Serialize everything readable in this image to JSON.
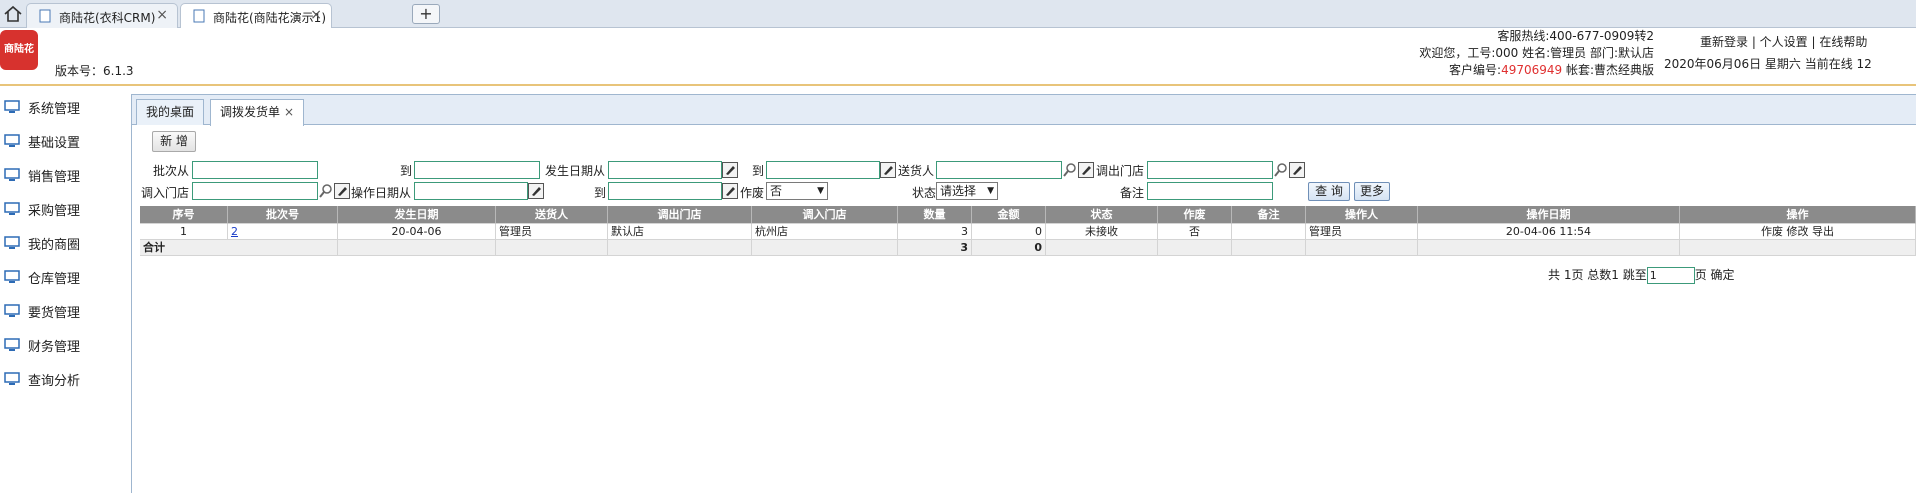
{
  "browser": {
    "tabs": [
      {
        "title": "商陆花(衣科CRM)"
      },
      {
        "title": "商陆花(商陆花演示1)"
      }
    ],
    "new_tab": "+"
  },
  "header": {
    "logo_text": "商陆花",
    "version": "版本号：6.1.3",
    "hotline": "客服热线:400-677-0909转2",
    "welcome": "欢迎您，工号:000 姓名:管理员 部门:默认店",
    "customer_label": "客户编号:",
    "customer_no": "49706949",
    "account": " 帐套:曹杰经典版",
    "links": "重新登录 | 个人设置 | 在线帮助",
    "date_online": "2020年06月06日 星期六 当前在线 12"
  },
  "sidebar": {
    "items": [
      {
        "label": "系统管理"
      },
      {
        "label": "基础设置"
      },
      {
        "label": "销售管理"
      },
      {
        "label": "采购管理"
      },
      {
        "label": "我的商圈"
      },
      {
        "label": "仓库管理"
      },
      {
        "label": "要货管理"
      },
      {
        "label": "财务管理"
      },
      {
        "label": "查询分析"
      }
    ]
  },
  "page_tabs": [
    {
      "label": "我的桌面"
    },
    {
      "label": "调拨发货单",
      "close": "×"
    }
  ],
  "toolbar": {
    "add_label": "新 增"
  },
  "filters": {
    "batch_from": "批次从",
    "batch_to": "到",
    "date_from": "发生日期从",
    "date_to": "到",
    "sender": "送货人",
    "out_store": "调出门店",
    "in_store": "调入门店",
    "op_date_from": "操作日期从",
    "op_date_to": "到",
    "void": "作废",
    "void_value": "否",
    "status": "状态",
    "status_value": "请选择",
    "remark": "备注",
    "query_label": "查 询",
    "more_label": "更多"
  },
  "table": {
    "columns": [
      "序号",
      "批次号",
      "发生日期",
      "送货人",
      "调出门店",
      "调入门店",
      "数量",
      "金额",
      "状态",
      "作废",
      "备注",
      "操作人",
      "操作日期",
      "操作"
    ],
    "rows": [
      {
        "no": "1",
        "batch": "2",
        "date": "20-04-06",
        "sender": "管理员",
        "out": "默认店",
        "in": "杭州店",
        "qty": "3",
        "amount": "0",
        "status": "未接收",
        "void": "否",
        "remark": "",
        "operator": "管理员",
        "op_date": "20-04-06 11:54",
        "actions": "作废 修改 导出"
      }
    ],
    "footer": {
      "label": "合计",
      "qty": "3",
      "amount": "0"
    }
  },
  "pager": {
    "text": "共 1页 总数1 跳至",
    "page_value": "1",
    "suffix": "页 确定"
  }
}
